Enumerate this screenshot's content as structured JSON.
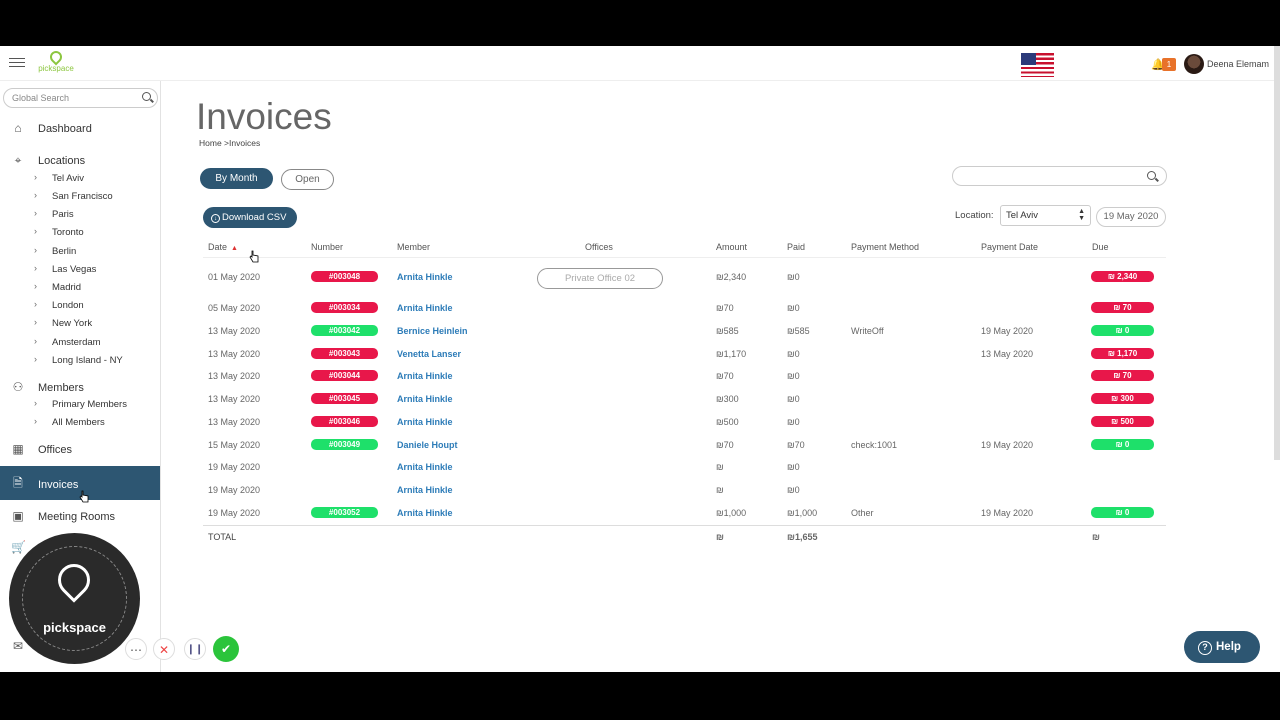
{
  "header": {
    "brand": "pickspace",
    "notification_count": "1",
    "user_name": "Deena Elemam"
  },
  "sidebar": {
    "search_placeholder": "Global Search",
    "items": [
      {
        "label": "Dashboard",
        "icon": "home-icon"
      },
      {
        "label": "Locations",
        "icon": "map-pin-icon"
      },
      {
        "label": "Members",
        "icon": "users-icon"
      },
      {
        "label": "Offices",
        "icon": "building-icon"
      },
      {
        "label": "Invoices",
        "icon": "invoice-icon"
      },
      {
        "label": "Meeting Rooms",
        "icon": "calendar-icon"
      }
    ],
    "locations": [
      "Tel Aviv",
      "San Francisco",
      "Paris",
      "Toronto",
      "Berlin",
      "Las Vegas",
      "Madrid",
      "London",
      "New York",
      "Amsterdam",
      "Long Island - NY"
    ],
    "members_sub": [
      "Primary Members",
      "All Members"
    ]
  },
  "overlay": {
    "brand": "pickspace"
  },
  "main": {
    "title": "Invoices",
    "breadcrumb": {
      "home": "Home",
      "sep": " >",
      "current": "Invoices"
    },
    "tabs": {
      "by_month": "By Month",
      "open": "Open"
    },
    "download_label": "Download CSV",
    "location_label": "Location:",
    "location_value": "Tel Aviv",
    "date_value": "19 May 2020",
    "help_label": "Help"
  },
  "table": {
    "columns": [
      "Date",
      "Number",
      "Member",
      "Offices",
      "Amount",
      "Paid",
      "Payment Method",
      "Payment Date",
      "Due"
    ],
    "rows": [
      {
        "date": "01 May 2020",
        "number": "#003048",
        "num_status": "red",
        "member": "Arnita Hinkle",
        "office": "Private Office 02",
        "amount": "₪2,340",
        "paid": "₪0",
        "method": "",
        "pay_date": "",
        "due": "₪ 2,340",
        "due_status": "red"
      },
      {
        "date": "05 May 2020",
        "number": "#003034",
        "num_status": "red",
        "member": "Arnita Hinkle",
        "office": "",
        "amount": "₪70",
        "paid": "₪0",
        "method": "",
        "pay_date": "",
        "due": "₪ 70",
        "due_status": "red"
      },
      {
        "date": "13 May 2020",
        "number": "#003042",
        "num_status": "green",
        "member": "Bernice Heinlein",
        "office": "",
        "amount": "₪585",
        "paid": "₪585",
        "method": "WriteOff",
        "pay_date": "19 May 2020",
        "due": "₪ 0",
        "due_status": "green"
      },
      {
        "date": "13 May 2020",
        "number": "#003043",
        "num_status": "red",
        "member": "Venetta Lanser",
        "office": "",
        "amount": "₪1,170",
        "paid": "₪0",
        "method": "",
        "pay_date": "13 May 2020",
        "due": "₪ 1,170",
        "due_status": "red"
      },
      {
        "date": "13 May 2020",
        "number": "#003044",
        "num_status": "red",
        "member": "Arnita Hinkle",
        "office": "",
        "amount": "₪70",
        "paid": "₪0",
        "method": "",
        "pay_date": "",
        "due": "₪ 70",
        "due_status": "red"
      },
      {
        "date": "13 May 2020",
        "number": "#003045",
        "num_status": "red",
        "member": "Arnita Hinkle",
        "office": "",
        "amount": "₪300",
        "paid": "₪0",
        "method": "",
        "pay_date": "",
        "due": "₪ 300",
        "due_status": "red"
      },
      {
        "date": "13 May 2020",
        "number": "#003046",
        "num_status": "red",
        "member": "Arnita Hinkle",
        "office": "",
        "amount": "₪500",
        "paid": "₪0",
        "method": "",
        "pay_date": "",
        "due": "₪ 500",
        "due_status": "red"
      },
      {
        "date": "15 May 2020",
        "number": "#003049",
        "num_status": "green",
        "member": "Daniele Houpt",
        "office": "",
        "amount": "₪70",
        "paid": "₪70",
        "method": "check:1001",
        "pay_date": "19 May 2020",
        "due": "₪ 0",
        "due_status": "green"
      },
      {
        "date": "19 May 2020",
        "number": "",
        "num_status": "",
        "member": "Arnita Hinkle",
        "office": "",
        "amount": "₪",
        "paid": "₪0",
        "method": "",
        "pay_date": "",
        "due": "",
        "due_status": ""
      },
      {
        "date": "19 May 2020",
        "number": "",
        "num_status": "",
        "member": "Arnita Hinkle",
        "office": "",
        "amount": "₪",
        "paid": "₪0",
        "method": "",
        "pay_date": "",
        "due": "",
        "due_status": ""
      },
      {
        "date": "19 May 2020",
        "number": "#003052",
        "num_status": "green",
        "member": "Arnita Hinkle",
        "office": "",
        "amount": "₪1,000",
        "paid": "₪1,000",
        "method": "Other",
        "pay_date": "19 May 2020",
        "due": "₪ 0",
        "due_status": "green"
      }
    ],
    "total": {
      "label": "TOTAL",
      "amount": "₪",
      "paid": "₪1,655",
      "due": "₪"
    }
  },
  "colors": {
    "primary": "#2d5672",
    "danger": "#e8174a",
    "success": "#1ee06a",
    "link": "#2d7cb8"
  }
}
